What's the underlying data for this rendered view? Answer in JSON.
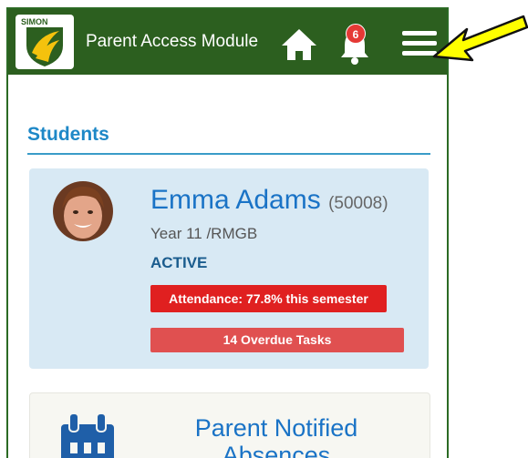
{
  "header": {
    "logo_text": "SIMON",
    "title": "Parent Access Module",
    "notification_count": "6"
  },
  "students_section": {
    "title": "Students"
  },
  "student": {
    "name": "Emma Adams",
    "id": "(50008)",
    "year": "Year 11 /RMGB",
    "status": "ACTIVE",
    "attendance": "Attendance: 77.8% this semester",
    "overdue": "14 Overdue Tasks"
  },
  "absence_card": {
    "title": "Parent Notified Absences"
  },
  "colors": {
    "header_bg": "#2c5f1f",
    "accent_blue": "#1a73c6",
    "card_bg": "#d8e9f4",
    "attendance_red": "#e02020",
    "overdue_red": "#e05050",
    "arrow_yellow": "#ffff00"
  },
  "icons": [
    "simon-logo",
    "home-icon",
    "bell-icon",
    "menu-icon",
    "calendar-icon",
    "pointer-arrow"
  ]
}
